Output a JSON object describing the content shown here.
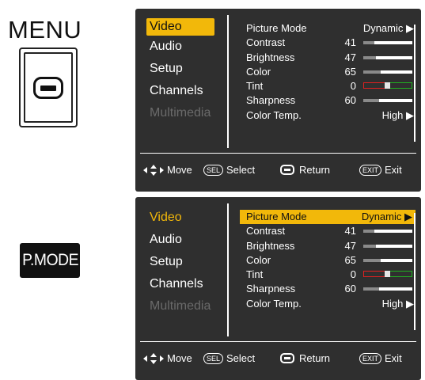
{
  "remote": {
    "menu_label": "MENU",
    "pmode_label": "P.MODE"
  },
  "osd_top": {
    "categories": [
      {
        "label": "Video",
        "state": "selected-box"
      },
      {
        "label": "Audio",
        "state": "normal"
      },
      {
        "label": "Setup",
        "state": "normal"
      },
      {
        "label": "Channels",
        "state": "normal"
      },
      {
        "label": "Multimedia",
        "state": "disabled"
      }
    ],
    "rows": {
      "picture_mode": {
        "label": "Picture Mode",
        "value": "Dynamic ▶"
      },
      "contrast": {
        "label": "Contrast",
        "value": "41",
        "level": 41
      },
      "brightness": {
        "label": "Brightness",
        "value": "47",
        "level": 47
      },
      "color": {
        "label": "Color",
        "value": "65",
        "level": 65
      },
      "tint": {
        "label": "Tint",
        "value": "0"
      },
      "sharpness": {
        "label": "Sharpness",
        "value": "60",
        "level": 60
      },
      "color_temp": {
        "label": "Color Temp.",
        "value": "High ▶"
      }
    },
    "footer": {
      "move": "Move",
      "sel_key": "SEL",
      "select": "Select",
      "return": "Return",
      "exit_key": "EXIT",
      "exit": "Exit"
    }
  },
  "osd_bottom": {
    "categories": [
      {
        "label": "Video",
        "state": "selected-text"
      },
      {
        "label": "Audio",
        "state": "normal"
      },
      {
        "label": "Setup",
        "state": "normal"
      },
      {
        "label": "Channels",
        "state": "normal"
      },
      {
        "label": "Multimedia",
        "state": "disabled"
      }
    ],
    "rows": {
      "picture_mode": {
        "label": "Picture Mode",
        "value": "Dynamic ▶",
        "highlighted": true
      },
      "contrast": {
        "label": "Contrast",
        "value": "41",
        "level": 41
      },
      "brightness": {
        "label": "Brightness",
        "value": "47",
        "level": 47
      },
      "color": {
        "label": "Color",
        "value": "65",
        "level": 65
      },
      "tint": {
        "label": "Tint",
        "value": "0"
      },
      "sharpness": {
        "label": "Sharpness",
        "value": "60",
        "level": 60
      },
      "color_temp": {
        "label": "Color Temp.",
        "value": "High ▶"
      }
    },
    "footer": {
      "move": "Move",
      "sel_key": "SEL",
      "select": "Select",
      "return": "Return",
      "exit_key": "EXIT",
      "exit": "Exit"
    }
  },
  "colors": {
    "panel": "#2f2f2f",
    "highlight": "#f2b80a",
    "bar_fill": "#8a8a8a",
    "tint_red": "#e02020",
    "tint_green": "#20b020"
  }
}
